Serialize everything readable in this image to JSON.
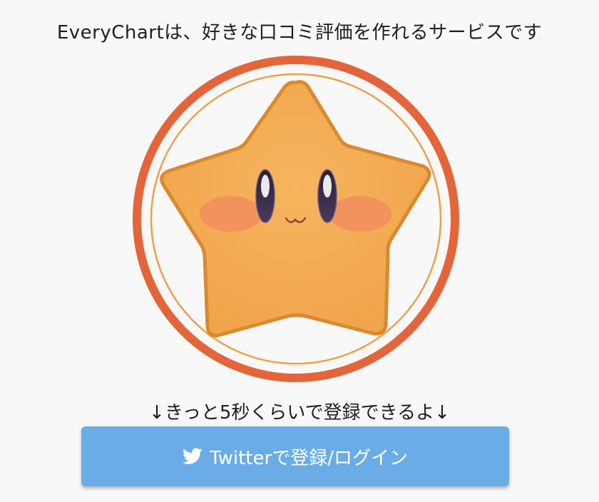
{
  "header": {
    "tagline": "EveryChartは、好きな口コミ評価を作れるサービスです"
  },
  "mascot": {
    "icon": "star-mascot-icon",
    "ring_color": "#e4653a",
    "inner_ring_color": "#eaa14a",
    "star_fill": "#f4ad57",
    "star_stroke": "#d98a30",
    "cheek_color": "#f18a60"
  },
  "signup": {
    "hint": "↓きっと5秒くらいで登録できるよ↓",
    "button_label": "Twitterで登録/ログイン",
    "button_icon": "twitter-bird-icon",
    "button_color": "#6aace6"
  }
}
